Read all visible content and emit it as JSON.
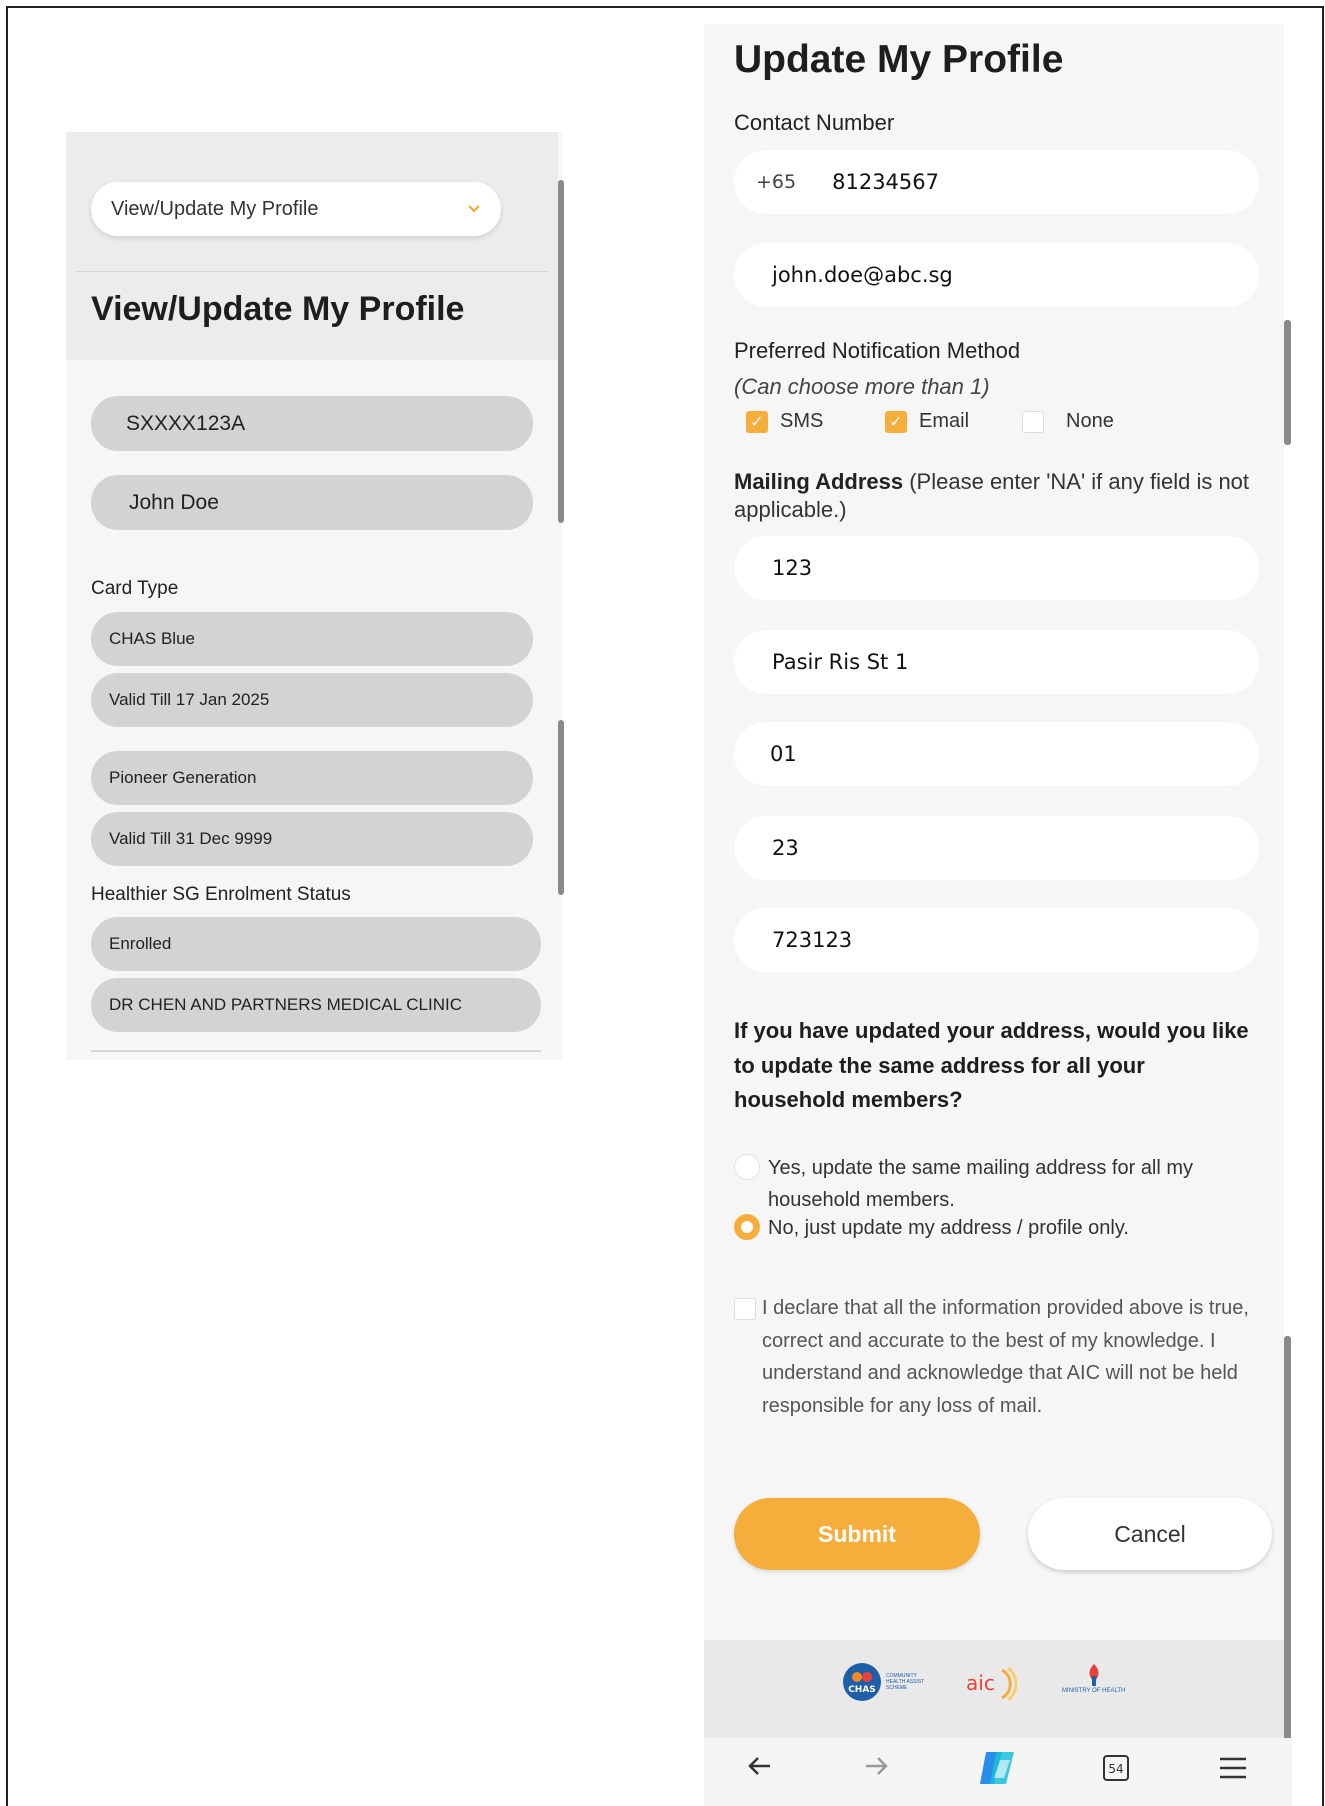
{
  "left": {
    "dropdown": {
      "label": "View/Update My Profile"
    },
    "title": "View/Update My Profile",
    "id_number": "SXXXX123A",
    "name": "John Doe",
    "card_type_label": "Card Type",
    "cards": [
      {
        "type": "CHAS Blue",
        "validity": "Valid Till 17 Jan 2025"
      },
      {
        "type": "Pioneer Generation",
        "validity": "Valid Till 31 Dec 9999"
      }
    ],
    "healthier_sg_label": "Healthier SG Enrolment Status",
    "enrolment_status": "Enrolled",
    "clinic": "DR CHEN AND PARTNERS MEDICAL CLINIC"
  },
  "right": {
    "title": "Update My Profile",
    "contact_label": "Contact Number",
    "country_code": "+65",
    "phone": "81234567",
    "email": "john.doe@abc.sg",
    "notification_label": "Preferred Notification Method",
    "notification_hint": "(Can choose more than 1)",
    "notification_options": [
      {
        "label": "SMS",
        "checked": true
      },
      {
        "label": "Email",
        "checked": true
      },
      {
        "label": "None",
        "checked": false
      }
    ],
    "mailing_label": "Mailing Address",
    "mailing_hint": "(Please enter 'NA' if any field is not applicable.)",
    "address": {
      "block": "123",
      "street": "Pasir Ris St 1",
      "floor": "01",
      "unit": "23",
      "postal": "723123"
    },
    "household_question": "If you have updated your address, would you like to update the same address for all your household members?",
    "household_options": [
      {
        "label": "Yes, update the same mailing address for all my household members.",
        "selected": false
      },
      {
        "label": "No, just update my address / profile only.",
        "selected": true
      }
    ],
    "declaration": "I declare that all the information provided above is true, correct and accurate to the best of my knowledge. I understand and acknowledge that AIC will not be held responsible for any loss of mail.",
    "declaration_checked": false,
    "submit_label": "Submit",
    "cancel_label": "Cancel",
    "footer_logos": {
      "chas": {
        "mark": "CHAS",
        "text": "COMMUNITY HEALTH ASSIST SCHEME"
      },
      "aic": {
        "mark": "aic"
      },
      "moh": {
        "text": "MINISTRY OF HEALTH"
      }
    },
    "navbar": {
      "tab_count": "54"
    }
  },
  "colors": {
    "accent": "#f5ad3c",
    "field_gray": "#d3d3d3",
    "panel_bg": "#f6f6f6"
  }
}
